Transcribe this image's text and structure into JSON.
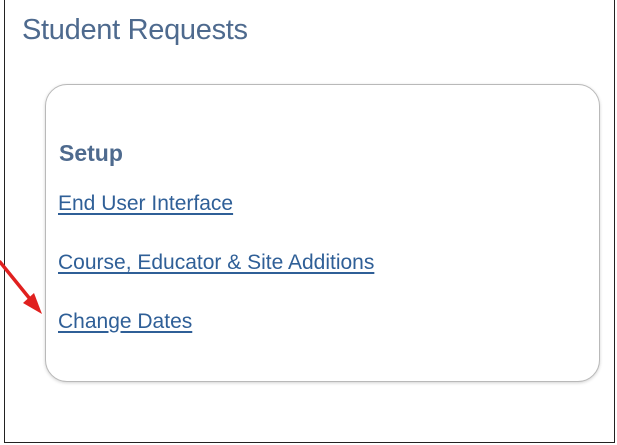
{
  "page": {
    "title": "Student Requests"
  },
  "setup": {
    "heading": "Setup",
    "links": [
      {
        "label": "End User Interface"
      },
      {
        "label": "Course, Educator & Site Additions"
      },
      {
        "label": "Change Dates"
      }
    ]
  },
  "annotation": {
    "arrow_color": "#e0201f",
    "points_to": "Change Dates"
  },
  "colors": {
    "heading": "#4e6a8e",
    "link": "#2f5f97",
    "card_border": "#b9b9b9"
  }
}
